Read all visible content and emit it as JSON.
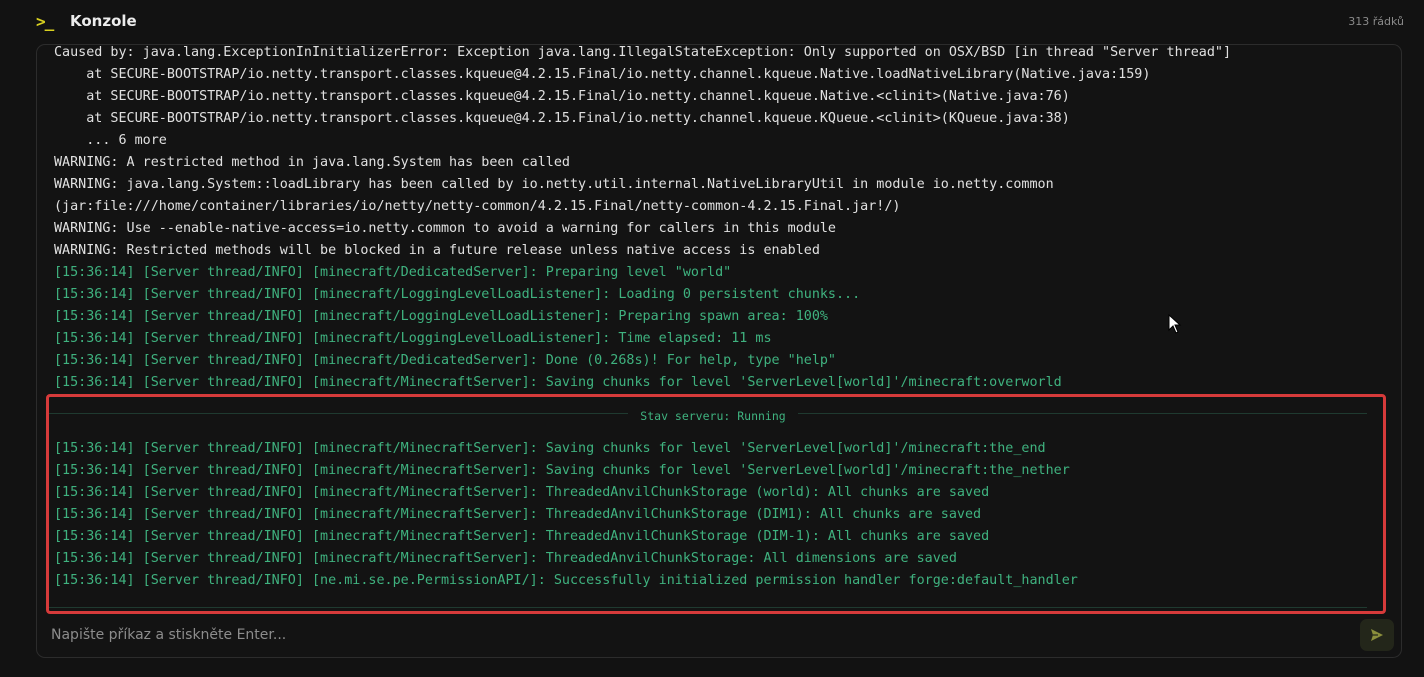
{
  "header": {
    "icon": "terminal-prompt-icon",
    "icon_glyph": ">_",
    "title": "Konzole",
    "line_count": "313 řádků"
  },
  "log_lines_above": [
    {
      "text": "Caused by: java.lang.ExceptionInInitializerError: Exception java.lang.IllegalStateException: Only supported on OSX/BSD [in thread \"Server thread\"]",
      "kind": "err"
    },
    {
      "text": "    at SECURE-BOOTSTRAP/io.netty.transport.classes.kqueue@4.2.15.Final/io.netty.channel.kqueue.Native.loadNativeLibrary(Native.java:159)",
      "kind": "err"
    },
    {
      "text": "    at SECURE-BOOTSTRAP/io.netty.transport.classes.kqueue@4.2.15.Final/io.netty.channel.kqueue.Native.<clinit>(Native.java:76)",
      "kind": "err"
    },
    {
      "text": "    at SECURE-BOOTSTRAP/io.netty.transport.classes.kqueue@4.2.15.Final/io.netty.channel.kqueue.KQueue.<clinit>(KQueue.java:38)",
      "kind": "err"
    },
    {
      "text": "    ... 6 more",
      "kind": "err"
    },
    {
      "text": "WARNING: A restricted method in java.lang.System has been called",
      "kind": "err"
    },
    {
      "text": "WARNING: java.lang.System::loadLibrary has been called by io.netty.util.internal.NativeLibraryUtil in module io.netty.common",
      "kind": "err"
    },
    {
      "text": "(jar:file:///home/container/libraries/io/netty/netty-common/4.2.15.Final/netty-common-4.2.15.Final.jar!/)",
      "kind": "err"
    },
    {
      "text": "WARNING: Use --enable-native-access=io.netty.common to avoid a warning for callers in this module",
      "kind": "err"
    },
    {
      "text": "WARNING: Restricted methods will be blocked in a future release unless native access is enabled",
      "kind": "err"
    },
    {
      "text": "[15:36:14] [Server thread/INFO] [minecraft/DedicatedServer]: Preparing level \"world\"",
      "kind": "info"
    },
    {
      "text": "[15:36:14] [Server thread/INFO] [minecraft/LoggingLevelLoadListener]: Loading 0 persistent chunks...",
      "kind": "info"
    },
    {
      "text": "[15:36:14] [Server thread/INFO] [minecraft/LoggingLevelLoadListener]: Preparing spawn area: 100%",
      "kind": "info"
    },
    {
      "text": "[15:36:14] [Server thread/INFO] [minecraft/LoggingLevelLoadListener]: Time elapsed: 11 ms",
      "kind": "info"
    },
    {
      "text": "[15:36:14] [Server thread/INFO] [minecraft/DedicatedServer]: Done (0.268s)! For help, type \"help\"",
      "kind": "info"
    },
    {
      "text": "[15:36:14] [Server thread/INFO] [minecraft/MinecraftServer]: Saving chunks for level 'ServerLevel[world]'/minecraft:overworld",
      "kind": "info"
    }
  ],
  "status": {
    "label": "Stav serveru: Running"
  },
  "log_lines_below": [
    {
      "text": "[15:36:14] [Server thread/INFO] [minecraft/MinecraftServer]: Saving chunks for level 'ServerLevel[world]'/minecraft:the_end",
      "kind": "info"
    },
    {
      "text": "[15:36:14] [Server thread/INFO] [minecraft/MinecraftServer]: Saving chunks for level 'ServerLevel[world]'/minecraft:the_nether",
      "kind": "info"
    },
    {
      "text": "[15:36:14] [Server thread/INFO] [minecraft/MinecraftServer]: ThreadedAnvilChunkStorage (world): All chunks are saved",
      "kind": "info"
    },
    {
      "text": "[15:36:14] [Server thread/INFO] [minecraft/MinecraftServer]: ThreadedAnvilChunkStorage (DIM1): All chunks are saved",
      "kind": "info"
    },
    {
      "text": "[15:36:14] [Server thread/INFO] [minecraft/MinecraftServer]: ThreadedAnvilChunkStorage (DIM-1): All chunks are saved",
      "kind": "info"
    },
    {
      "text": "[15:36:14] [Server thread/INFO] [minecraft/MinecraftServer]: ThreadedAnvilChunkStorage: All dimensions are saved",
      "kind": "info"
    },
    {
      "text": "[15:36:14] [Server thread/INFO] [ne.mi.se.pe.PermissionAPI/]: Successfully initialized permission handler forge:default_handler",
      "kind": "info"
    }
  ],
  "input": {
    "placeholder": "Napište příkaz a stiskněte Enter...",
    "value": ""
  },
  "send_button": {
    "icon": "send-icon"
  },
  "colors": {
    "accent_yellow": "#d8d020",
    "info_green": "#3fb27f",
    "highlight_red": "#d63a3a",
    "background": "#131313"
  }
}
